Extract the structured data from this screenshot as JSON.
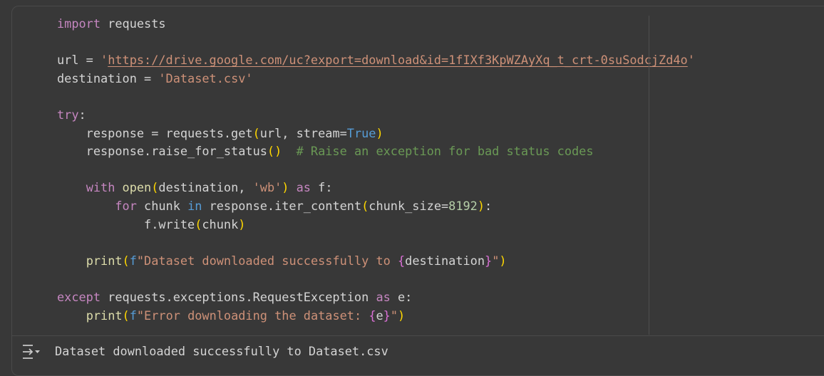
{
  "code_lines": [
    [
      {
        "t": "import",
        "c": "kw"
      },
      {
        "t": " requests",
        "c": ""
      }
    ],
    [],
    [
      {
        "t": "url = ",
        "c": ""
      },
      {
        "t": "'",
        "c": "str"
      },
      {
        "t": "https://drive.google.com/uc?export=download&id=1fIXf3KpWZAyXq_t_crt-0suSodcjZd4o",
        "c": "str link"
      },
      {
        "t": "'",
        "c": "str"
      }
    ],
    [
      {
        "t": "destination = ",
        "c": ""
      },
      {
        "t": "'Dataset.csv'",
        "c": "str"
      }
    ],
    [],
    [
      {
        "t": "try",
        "c": "kw"
      },
      {
        "t": ":",
        "c": ""
      }
    ],
    [
      {
        "t": "    response = requests.get",
        "c": ""
      },
      {
        "t": "(",
        "c": "br"
      },
      {
        "t": "url, stream=",
        "c": ""
      },
      {
        "t": "True",
        "c": "bl"
      },
      {
        "t": ")",
        "c": "br"
      }
    ],
    [
      {
        "t": "    response.raise_for_status",
        "c": ""
      },
      {
        "t": "()",
        "c": "br"
      },
      {
        "t": "  # Raise an exception for bad status codes",
        "c": "cm"
      }
    ],
    [],
    [
      {
        "t": "    ",
        "c": ""
      },
      {
        "t": "with",
        "c": "kw"
      },
      {
        "t": " ",
        "c": ""
      },
      {
        "t": "open",
        "c": "fn"
      },
      {
        "t": "(",
        "c": "br"
      },
      {
        "t": "destination, ",
        "c": ""
      },
      {
        "t": "'wb'",
        "c": "str"
      },
      {
        "t": ")",
        "c": "br"
      },
      {
        "t": " ",
        "c": ""
      },
      {
        "t": "as",
        "c": "kw"
      },
      {
        "t": " f:",
        "c": ""
      }
    ],
    [
      {
        "t": "        ",
        "c": ""
      },
      {
        "t": "for",
        "c": "kw"
      },
      {
        "t": " chunk ",
        "c": ""
      },
      {
        "t": "in",
        "c": "bl"
      },
      {
        "t": " response.iter_content",
        "c": ""
      },
      {
        "t": "(",
        "c": "br"
      },
      {
        "t": "chunk_size=",
        "c": ""
      },
      {
        "t": "8192",
        "c": "num"
      },
      {
        "t": ")",
        "c": "br"
      },
      {
        "t": ":",
        "c": ""
      }
    ],
    [
      {
        "t": "            f.write",
        "c": ""
      },
      {
        "t": "(",
        "c": "br"
      },
      {
        "t": "chunk",
        "c": ""
      },
      {
        "t": ")",
        "c": "br"
      }
    ],
    [],
    [
      {
        "t": "    ",
        "c": ""
      },
      {
        "t": "print",
        "c": "fn"
      },
      {
        "t": "(",
        "c": "br"
      },
      {
        "t": "f",
        "c": "bl"
      },
      {
        "t": "\"Dataset downloaded successfully to ",
        "c": "str"
      },
      {
        "t": "{",
        "c": "br2"
      },
      {
        "t": "destination",
        "c": ""
      },
      {
        "t": "}",
        "c": "br2"
      },
      {
        "t": "\"",
        "c": "str"
      },
      {
        "t": ")",
        "c": "br"
      }
    ],
    [],
    [
      {
        "t": "except",
        "c": "kw"
      },
      {
        "t": " requests.exceptions.RequestException ",
        "c": ""
      },
      {
        "t": "as",
        "c": "kw"
      },
      {
        "t": " e:",
        "c": ""
      }
    ],
    [
      {
        "t": "    ",
        "c": ""
      },
      {
        "t": "print",
        "c": "fn"
      },
      {
        "t": "(",
        "c": "br"
      },
      {
        "t": "f",
        "c": "bl"
      },
      {
        "t": "\"Error downloading the dataset: ",
        "c": "str"
      },
      {
        "t": "{",
        "c": "br2"
      },
      {
        "t": "e",
        "c": ""
      },
      {
        "t": "}",
        "c": "br2"
      },
      {
        "t": "\"",
        "c": "str"
      },
      {
        "t": ")",
        "c": "br"
      }
    ]
  ],
  "output": {
    "icon": "output-toggle-icon",
    "text": "Dataset downloaded successfully to Dataset.csv"
  }
}
